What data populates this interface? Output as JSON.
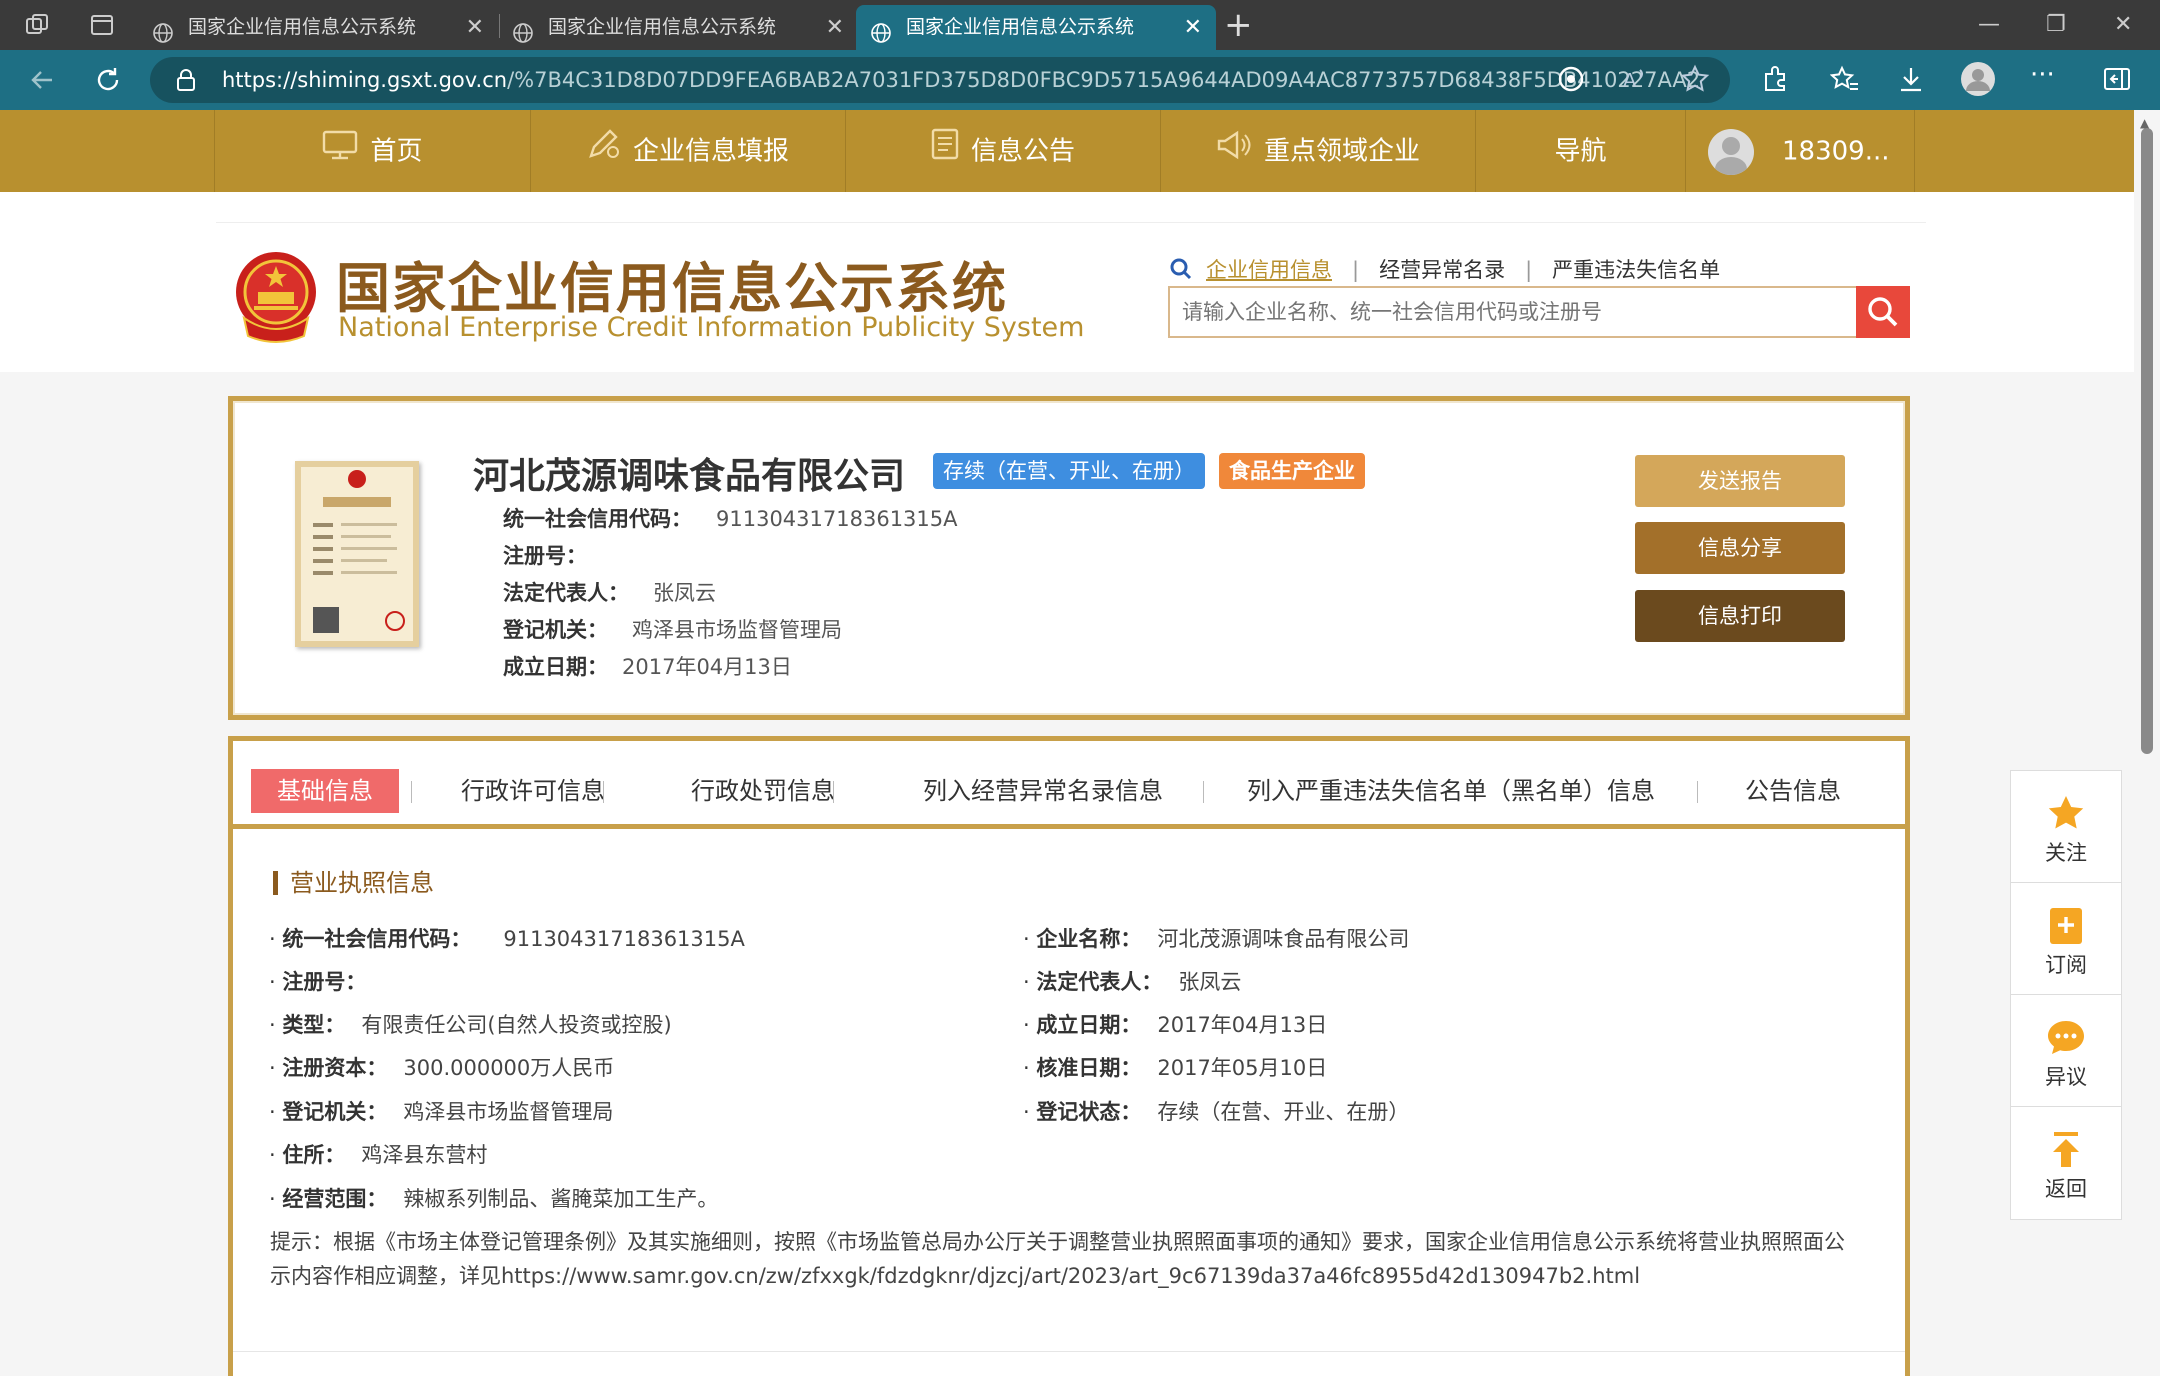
{
  "browser": {
    "tabs": [
      {
        "title": "国家企业信用信息公示系统",
        "active": false
      },
      {
        "title": "国家企业信用信息公示系统",
        "active": false
      },
      {
        "title": "国家企业信用信息公示系统",
        "active": true
      }
    ],
    "url_domain": "https://shiming.gsxt.gov.cn",
    "url_path": "/%7B4C31D8D07DD9FEA6BAB2A7031FD375D8D0FBC9D5715A9644AD09A4AC8773757D68438F5DB410227AA2..."
  },
  "site_nav": {
    "items": [
      {
        "label": "首页",
        "icon": "monitor-icon"
      },
      {
        "label": "企业信息填报",
        "icon": "edit-icon"
      },
      {
        "label": "信息公告",
        "icon": "document-icon"
      },
      {
        "label": "重点领域企业",
        "icon": "megaphone-icon"
      },
      {
        "label": "导航"
      }
    ],
    "user": "18309..."
  },
  "header": {
    "logo_cn": "国家企业信用信息公示系统",
    "logo_en": "National Enterprise Credit Information Publicity System",
    "search_links": [
      "企业信用信息",
      "经营异常名录",
      "严重违法失信名单"
    ],
    "search_placeholder": "请输入企业名称、统一社会信用代码或注册号"
  },
  "company": {
    "name": "河北茂源调味食品有限公司",
    "status_badge": "存续（在营、开业、在册）",
    "type_badge": "食品生产企业",
    "fields": [
      {
        "label": "统一社会信用代码：",
        "value": "91130431718361315A"
      },
      {
        "label": "注册号：",
        "value": ""
      },
      {
        "label": "法定代表人：",
        "value": "张凤云"
      },
      {
        "label": "登记机关：",
        "value": "鸡泽县市场监督管理局"
      },
      {
        "label": "成立日期：",
        "value": "2017年04月13日"
      }
    ],
    "actions": [
      {
        "label": "发送报告",
        "color": "#d4a75a"
      },
      {
        "label": "信息分享",
        "color": "#a3702a"
      },
      {
        "label": "信息打印",
        "color": "#6b4a1e"
      }
    ]
  },
  "tabs": [
    "基础信息",
    "行政许可信息",
    "行政处罚信息",
    "列入经营异常名录信息",
    "列入严重违法失信名单（黑名单）信息",
    "公告信息"
  ],
  "license_section": {
    "title": "营业执照信息",
    "left": [
      {
        "label": "统一社会信用代码：",
        "value": "91130431718361315A"
      },
      {
        "label": "注册号：",
        "value": ""
      },
      {
        "label": "类型：",
        "value": "有限责任公司(自然人投资或控股)"
      },
      {
        "label": "注册资本：",
        "value": "300.000000万人民币"
      },
      {
        "label": "登记机关：",
        "value": "鸡泽县市场监督管理局"
      },
      {
        "label": "住所：",
        "value": "鸡泽县东营村"
      },
      {
        "label": "经营范围：",
        "value": "辣椒系列制品、酱腌菜加工生产。"
      }
    ],
    "right": [
      {
        "label": "企业名称：",
        "value": "河北茂源调味食品有限公司"
      },
      {
        "label": "法定代表人：",
        "value": "张凤云"
      },
      {
        "label": "成立日期：",
        "value": "2017年04月13日"
      },
      {
        "label": "核准日期：",
        "value": "2017年05月10日"
      },
      {
        "label": "登记状态：",
        "value": "存续（在营、开业、在册）"
      }
    ],
    "note": "提示：根据《市场主体登记管理条例》及其实施细则，按照《市场监管总局办公厅关于调整营业执照照面事项的通知》要求，国家企业信用信息公示系统将营业执照照面公示内容作相应调整，详见https://www.samr.gov.cn/zw/zfxxgk/fdzdgknr/djzcj/art/2023/art_9c67139da37a46fc8955d42d130947b2.html"
  },
  "side_float": [
    {
      "label": "关注",
      "icon": "star-icon"
    },
    {
      "label": "订阅",
      "icon": "subscribe-icon"
    },
    {
      "label": "异议",
      "icon": "chat-icon"
    },
    {
      "label": "返回",
      "icon": "back-to-top-icon"
    }
  ],
  "colors": {
    "nav_gold": "#b8902f",
    "brand_brown": "#8b5a1e",
    "active_tab": "#f06a6a",
    "status_blue": "#3e8ee0",
    "food_orange": "#f0883a",
    "browser_teal": "#1e6f84"
  }
}
